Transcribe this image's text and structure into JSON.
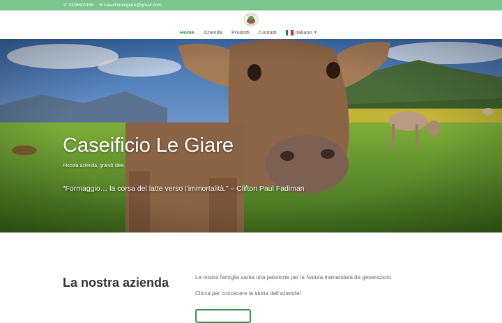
{
  "topbar": {
    "phone": "3336600158",
    "email": "caseificiolegiare@gmail.com",
    "phone_icon": "phone-icon",
    "email_icon": "envelope-icon"
  },
  "header": {
    "logo_icon": "caseificio-logo",
    "nav": [
      {
        "label": "Home",
        "active": true
      },
      {
        "label": "Azienda",
        "active": false
      },
      {
        "label": "Prodotti",
        "active": false
      },
      {
        "label": "Contatti",
        "active": false
      }
    ],
    "language": {
      "label": "Italiano",
      "flag_icon": "italy-flag-icon",
      "caret_icon": "caret-down-icon"
    }
  },
  "hero": {
    "title": "Caseificio Le Giare",
    "subtitle": "Piccola azienda, grandi idee.",
    "quote": "“Formaggio… la corsa del latte verso l’immortalità.” – Clifton Paul Fadiman"
  },
  "about": {
    "title": "La nostra azienda",
    "paragraph_1": "La nostra famiglia vanta una passione per la Natura tramandata da generazioni.",
    "paragraph_2": "Clicca per conoscere la storia dell’azienda!"
  },
  "colors": {
    "topbar": "#7bc68f",
    "accent": "#3f8f4c",
    "text": "#333333"
  }
}
